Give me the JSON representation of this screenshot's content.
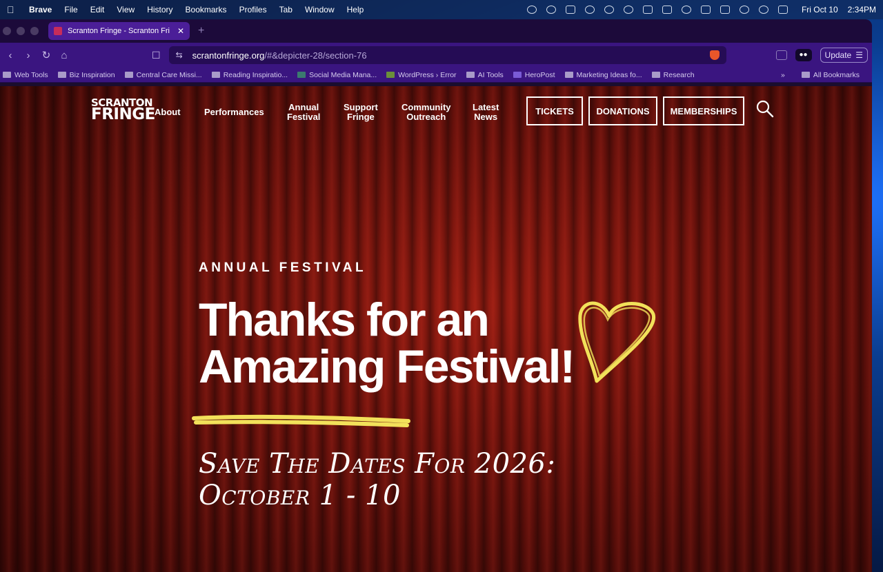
{
  "menubar": {
    "app": "Brave",
    "items": [
      "File",
      "Edit",
      "View",
      "History",
      "Bookmarks",
      "Profiles",
      "Tab",
      "Window",
      "Help"
    ],
    "clock_date": "Fri Oct 10",
    "clock_time": "2:34PM"
  },
  "browser": {
    "tab_title": "Scranton Fringe - Scranton Fri",
    "url_host": "scrantonfringe.org",
    "url_path": "/#&depicter-28/section-76",
    "update_label": "Update",
    "bookmarks": [
      "Web Tools",
      "Biz Inspiration",
      "Central Care Missi...",
      "Reading Inspiratio...",
      "Social Media Mana...",
      "WordPress › Error",
      "AI Tools",
      "HeroPost",
      "Marketing Ideas fo...",
      "Research"
    ],
    "more_bookmarks": "»",
    "all_bookmarks": "All Bookmarks"
  },
  "site": {
    "logo_line1": "SCRANTON",
    "logo_line2": "FRINGE",
    "nav": [
      {
        "line1": "About",
        "line2": ""
      },
      {
        "line1": "Performances",
        "line2": ""
      },
      {
        "line1": "Annual",
        "line2": "Festival"
      },
      {
        "line1": "Support",
        "line2": "Fringe"
      },
      {
        "line1": "Community",
        "line2": "Outreach"
      },
      {
        "line1": "Latest",
        "line2": "News"
      }
    ],
    "cta": [
      "TICKETS",
      "DONATIONS",
      "MEMBERSHIPS"
    ]
  },
  "hero": {
    "eyebrow": "ANNUAL FESTIVAL",
    "title_line1": "Thanks for an",
    "title_line2": "Amazing Festival!",
    "dates_line1": "Save The Dates For 2026:",
    "dates_line2": "October 1 - 10",
    "accent_color": "#f2e15a",
    "curtain_color": "#7a150e"
  }
}
